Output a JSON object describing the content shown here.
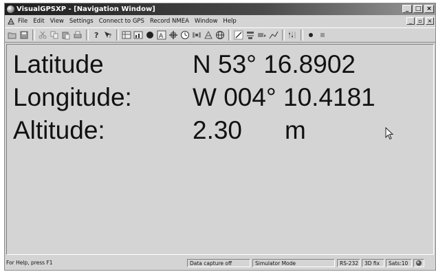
{
  "window": {
    "title": "VisualGPSXP - [Navigation Window]",
    "controls": [
      "_",
      "□",
      "×"
    ]
  },
  "menubar": {
    "items": [
      "File",
      "Edit",
      "View",
      "Settings",
      "Connect to GPS",
      "Record NMEA",
      "Window",
      "Help"
    ],
    "mdi_controls": [
      "_",
      "▫",
      "×"
    ]
  },
  "toolbar": {
    "icons": [
      "open-icon",
      "save-icon",
      "cut-icon",
      "copy-icon",
      "paste-icon",
      "print-icon",
      "help-icon",
      "context-help-icon",
      "grid-icon",
      "chart-icon",
      "record-dot-icon",
      "azimuth-icon",
      "crosshair-icon",
      "clock-icon",
      "satellite-icon",
      "survey-icon",
      "globe-icon",
      "pencil-icon",
      "list-icon",
      "paint-icon",
      "line-icon",
      "settings-icon",
      "record-icon",
      "stop-icon"
    ]
  },
  "navigation": {
    "latitude_label": "Latitude",
    "latitude_value": "N 53° 16.8902",
    "longitude_label": "Longitude:",
    "longitude_value": "W 004° 10.4181",
    "altitude_label": "Altitude:",
    "altitude_value": "2.30",
    "altitude_unit": "m"
  },
  "statusbar": {
    "help_text": "For Help, press F1",
    "capture": "Data capture off",
    "mode": "Simulator Mode",
    "port": "RS-232",
    "fix": "3D fix",
    "sats": "Sats:10"
  }
}
